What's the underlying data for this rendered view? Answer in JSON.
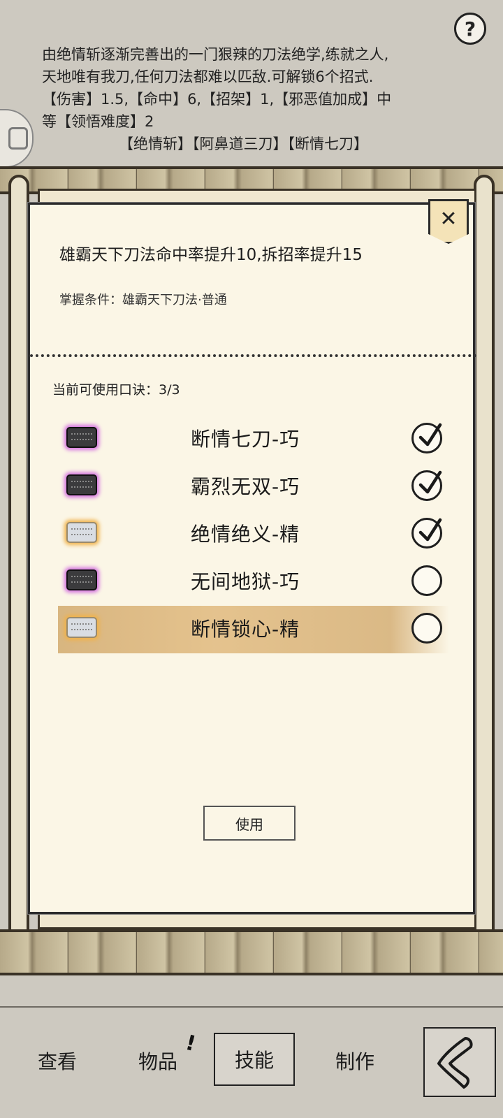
{
  "description": {
    "line1": "由绝情斩逐渐完善出的一门狠辣的刀法绝学,练就之人,",
    "line2": "天地唯有我刀,任何刀法都难以匹敌.可解锁6个招式.",
    "line3": "【伤害】1.5,【命中】6,【招架】1,【邪恶值加成】中",
    "line4": "等【领悟难度】2",
    "line5": "【绝情斩】【阿鼻道三刀】【断情七刀】"
  },
  "modal": {
    "close_symbol": "✕",
    "effect": "雄霸天下刀法命中率提升10,拆招率提升15",
    "condition": "掌握条件：雄霸天下刀法·普通",
    "count_label": "当前可使用口诀：3/3",
    "use_button": "使用",
    "skills": [
      {
        "name": "断情七刀-巧",
        "book": "purple",
        "checked": true,
        "selected": false
      },
      {
        "name": "霸烈无双-巧",
        "book": "purple",
        "checked": true,
        "selected": false
      },
      {
        "name": "绝情绝义-精",
        "book": "orange",
        "checked": true,
        "selected": false
      },
      {
        "name": "无间地狱-巧",
        "book": "purple",
        "checked": false,
        "selected": false
      },
      {
        "name": "断情锁心-精",
        "book": "orange",
        "checked": false,
        "selected": true
      }
    ]
  },
  "help_symbol": "?",
  "nav": {
    "view": "查看",
    "items": "物品",
    "items_alert": "!",
    "skills": "技能",
    "craft": "制作"
  },
  "colors": {
    "paper": "#fbf6e6",
    "selected_row": "#e2bd84",
    "rare_purple": "#d46fe0",
    "rare_orange": "#f0b24a"
  }
}
